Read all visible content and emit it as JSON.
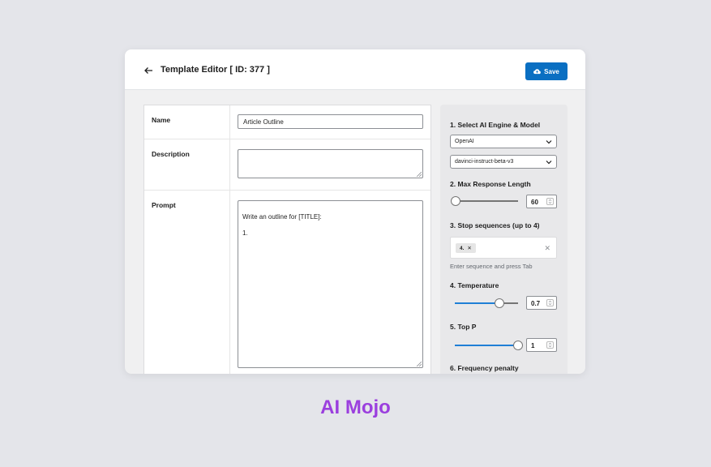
{
  "header": {
    "title": "Template Editor [ ID: 377 ]",
    "save_label": "Save"
  },
  "form": {
    "name_label": "Name",
    "name_value": "Article Outline",
    "description_label": "Description",
    "description_value": "",
    "prompt_label": "Prompt",
    "prompt_value": "Write an outline for [TITLE]:\n\n1."
  },
  "settings": {
    "engine_title": "1. Select AI Engine & Model",
    "engine_value": "OpenAI",
    "model_value": "davinci-instruct-beta-v3",
    "max_length_title": "2. Max Response Length",
    "max_length_value": "60",
    "max_length_level": 0.02,
    "stop_title": "3. Stop sequences (up to 4)",
    "stop_tag": "4.",
    "stop_hint": "Enter sequence and press Tab",
    "temperature_title": "4. Temperature",
    "temperature_value": "0.7",
    "temperature_level": 0.7,
    "top_p_title": "5. Top P",
    "top_p_value": "1",
    "top_p_level": 1.0,
    "frequency_title": "6. Frequency penalty"
  },
  "brand": {
    "label": "AI Mojo",
    "color": "#9b3fde"
  },
  "colors": {
    "accent": "#0a6fc2",
    "slider_fill": "#1f7fd6"
  },
  "icons": [
    "arrow-left-icon",
    "cloud-upload-icon",
    "chevron-down-icon",
    "close-icon",
    "resize-grip-icon",
    "spinner-arrows-icon"
  ]
}
